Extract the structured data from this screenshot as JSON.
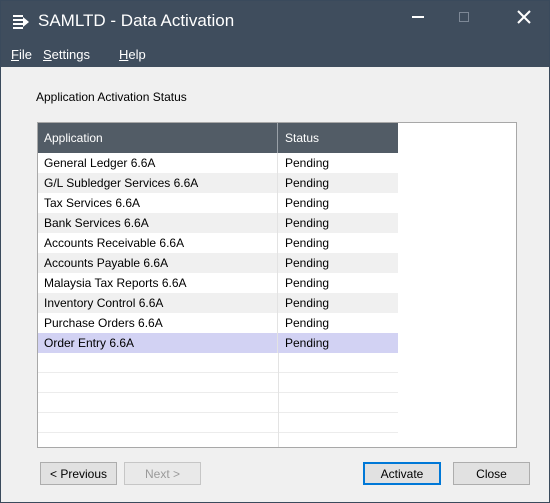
{
  "window": {
    "title": "SAMLTD - Data Activation",
    "controls": {
      "minimize": "−",
      "maximize": "□",
      "close": "✕"
    }
  },
  "menu": {
    "items": [
      {
        "label": "File"
      },
      {
        "label": "Settings"
      },
      {
        "label": "Help"
      }
    ]
  },
  "section": {
    "label": "Application Activation Status"
  },
  "table": {
    "columns": [
      "Application",
      "Status"
    ],
    "rows": [
      {
        "application": "General Ledger 6.6A",
        "status": "Pending"
      },
      {
        "application": "G/L Subledger Services 6.6A",
        "status": "Pending"
      },
      {
        "application": "Tax Services 6.6A",
        "status": "Pending"
      },
      {
        "application": "Bank Services 6.6A",
        "status": "Pending"
      },
      {
        "application": "Accounts Receivable 6.6A",
        "status": "Pending"
      },
      {
        "application": "Accounts Payable 6.6A",
        "status": "Pending"
      },
      {
        "application": "Malaysia Tax Reports 6.6A",
        "status": "Pending"
      },
      {
        "application": "Inventory Control 6.6A",
        "status": "Pending"
      },
      {
        "application": "Purchase Orders 6.6A",
        "status": "Pending"
      },
      {
        "application": "Order Entry 6.6A",
        "status": "Pending"
      }
    ],
    "selected_index": 9
  },
  "buttons": {
    "previous": "< Previous",
    "next": "Next >",
    "activate": "Activate",
    "close": "Close"
  },
  "colors": {
    "titlebar": "#3f4d5d",
    "header": "#525c66",
    "selection": "#d2d2f3",
    "default_button_border": "#0078d7"
  }
}
